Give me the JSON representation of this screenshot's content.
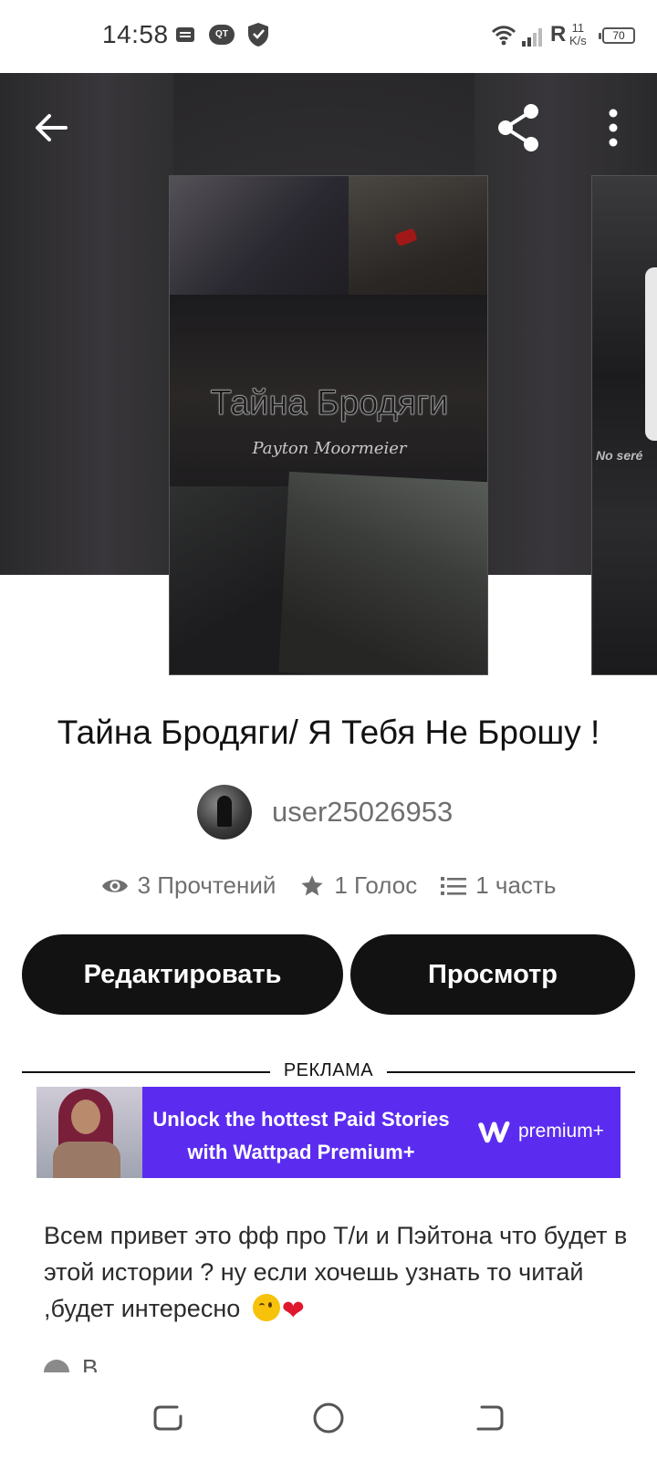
{
  "status_bar": {
    "time": "14:58",
    "qt_badge": "QT",
    "network_letter": "R",
    "speed_value": "11",
    "speed_unit": "K/s",
    "battery": "70"
  },
  "icons": {
    "back": "arrow-left-icon",
    "share": "share-icon",
    "more": "more-vertical-icon",
    "reads": "eye-icon",
    "votes": "star-icon",
    "parts": "list-icon"
  },
  "cover": {
    "title": "Тайна Бродяги",
    "subtitle": "Payton Moormeier"
  },
  "next_cover": {
    "caption": "No seré"
  },
  "story": {
    "title": "Тайна Бродяги/ Я Тебя Не Брошу !",
    "author": "user25026953",
    "reads": "3 Прочтений",
    "votes": "1 Голос",
    "parts": "1 часть"
  },
  "actions": {
    "edit_label": "Редактировать",
    "view_label": "Просмотр"
  },
  "ad": {
    "label": "РЕКЛАМА",
    "line1": "Unlock the hottest Paid Stories",
    "line2": "with Wattpad Premium+",
    "brand": "premium+"
  },
  "description": "Всем привет это фф про Т/и и Пэйтона что будет в этой истории ? ну если хочешь узнать то читай ,будет интересно",
  "description_emojis": [
    "😉",
    "❤️"
  ],
  "cut_text": "В",
  "colors": {
    "header_bg": "#2e2d2f",
    "button_bg": "#121212",
    "ad_bg": "#5b2cf0",
    "muted_text": "#6f6f6f"
  }
}
